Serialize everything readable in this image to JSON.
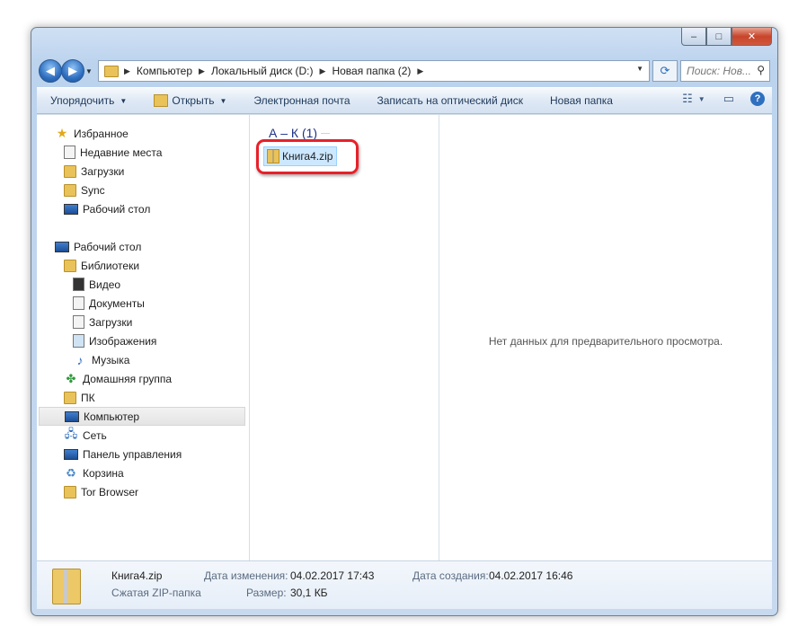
{
  "window": {
    "caption_buttons": {
      "minimize": "–",
      "maximize": "□",
      "close": "✕"
    }
  },
  "address": {
    "crumbs": [
      "Компьютер",
      "Локальный диск (D:)",
      "Новая папка (2)"
    ],
    "search_placeholder": "Поиск: Нов..."
  },
  "toolbar": {
    "organize": "Упорядочить",
    "open": "Открыть",
    "email": "Электронная почта",
    "burn": "Записать на оптический диск",
    "new_folder": "Новая папка"
  },
  "sidebar": {
    "favorites": {
      "title": "Избранное",
      "items": [
        "Недавние места",
        "Загрузки",
        "Sync",
        "Рабочий стол"
      ]
    },
    "desktop": "Рабочий стол",
    "libraries": {
      "title": "Библиотеки",
      "items": [
        "Видео",
        "Документы",
        "Загрузки",
        "Изображения",
        "Музыка"
      ]
    },
    "other": [
      "Домашняя группа",
      "ПК",
      "Компьютер",
      "Сеть",
      "Панель управления",
      "Корзина",
      "Tor Browser"
    ]
  },
  "files": {
    "group_header": "А – К (1)",
    "items": [
      "Книга4.zip"
    ]
  },
  "preview": {
    "empty_text": "Нет данных для предварительного просмотра."
  },
  "details": {
    "name": "Книга4.zip",
    "type": "Сжатая ZIP-папка",
    "modified_label": "Дата изменения:",
    "modified_value": "04.02.2017 17:43",
    "size_label": "Размер:",
    "size_value": "30,1 КБ",
    "created_label": "Дата создания:",
    "created_value": "04.02.2017 16:46"
  }
}
